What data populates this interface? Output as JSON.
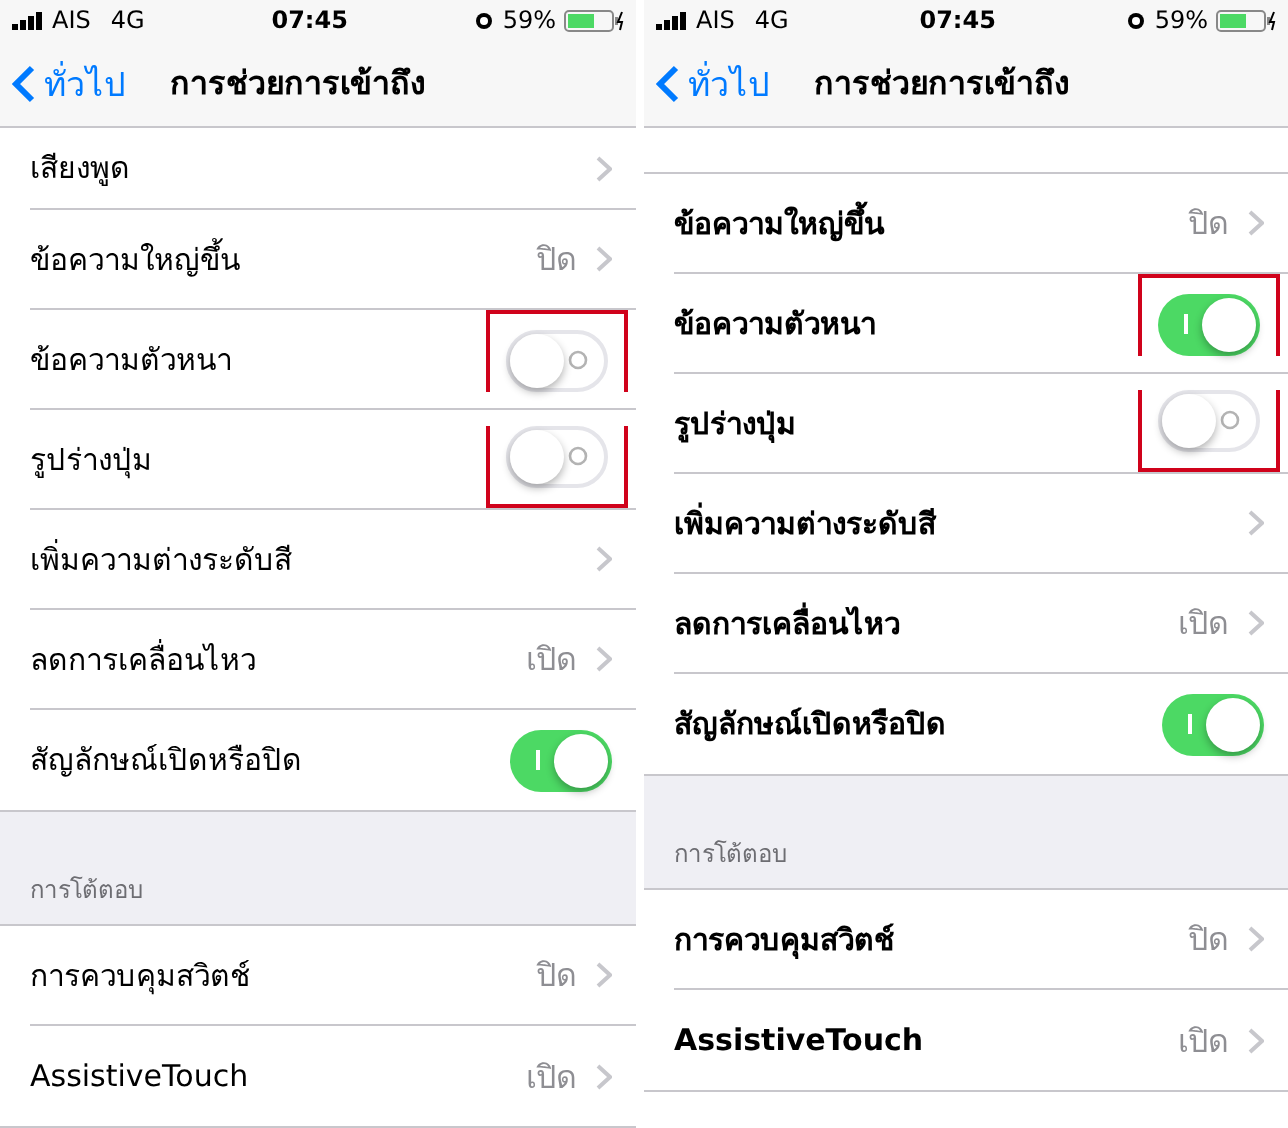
{
  "panels": [
    {
      "status_bar": {
        "carrier": "AIS",
        "network": "4G",
        "time": "07:45",
        "battery": "59%"
      },
      "nav": {
        "back": "ทั่วไป",
        "title": "การช่วยการเข้าถึง"
      },
      "bold_text": false,
      "cut_top_row": false,
      "rows": [
        {
          "kind": "link",
          "label": "เสียงพูด"
        },
        {
          "kind": "link",
          "label": "ข้อความใหญ่ขึ้น",
          "value": "ปิด"
        },
        {
          "kind": "toggle",
          "label": "ข้อความตัวหนา",
          "on": false,
          "highlighted": true
        },
        {
          "kind": "toggle",
          "label": "รูปร่างปุ่ม",
          "on": false,
          "highlighted": true
        },
        {
          "kind": "link",
          "label": "เพิ่มความต่างระดับสี"
        },
        {
          "kind": "link",
          "label": "ลดการเคลื่อนไหว",
          "value": "เปิด"
        },
        {
          "kind": "toggle",
          "label": "สัญลักษณ์เปิดหรือปิด",
          "on": true,
          "highlighted": false
        }
      ],
      "section": {
        "header": "การโต้ตอบ",
        "rows": [
          {
            "kind": "link",
            "label": "การควบคุมสวิตช์",
            "value": "ปิด"
          },
          {
            "kind": "link",
            "label": "AssistiveTouch",
            "value": "เปิด"
          }
        ]
      }
    },
    {
      "status_bar": {
        "carrier": "AIS",
        "network": "4G",
        "time": "07:45",
        "battery": "59%"
      },
      "nav": {
        "back": "ทั่วไป",
        "title": "การช่วยการเข้าถึง"
      },
      "bold_text": true,
      "cut_top_row": true,
      "rows": [
        {
          "kind": "link",
          "label": "ข้อความใหญ่ขึ้น",
          "value": "ปิด"
        },
        {
          "kind": "toggle",
          "label": "ข้อความตัวหนา",
          "on": true,
          "highlighted": true
        },
        {
          "kind": "toggle",
          "label": "รูปร่างปุ่ม",
          "on": false,
          "highlighted": true
        },
        {
          "kind": "link",
          "label": "เพิ่มความต่างระดับสี"
        },
        {
          "kind": "link",
          "label": "ลดการเคลื่อนไหว",
          "value": "เปิด"
        },
        {
          "kind": "toggle",
          "label": "สัญลักษณ์เปิดหรือปิด",
          "on": true,
          "highlighted": false
        }
      ],
      "section": {
        "header": "การโต้ตอบ",
        "rows": [
          {
            "kind": "link",
            "label": "การควบคุมสวิตช์",
            "value": "ปิด"
          },
          {
            "kind": "link",
            "label": "AssistiveTouch",
            "value": "เปิด"
          }
        ]
      }
    }
  ]
}
